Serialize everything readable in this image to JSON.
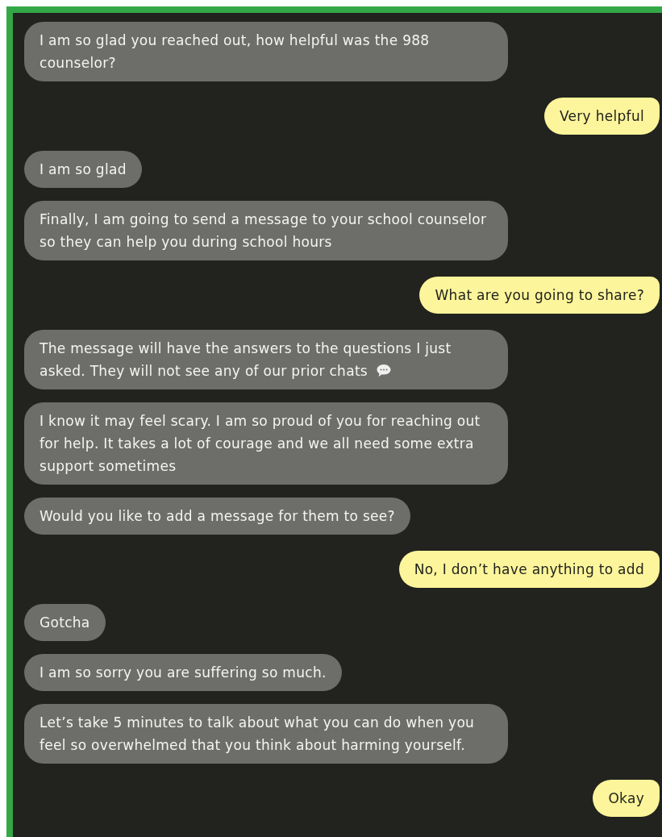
{
  "messages": [
    {
      "kind": "bot",
      "text": "I am so glad you reached out, how helpful was the 988 counselor?",
      "icon": false
    },
    {
      "kind": "user",
      "text": "Very helpful",
      "icon": false
    },
    {
      "kind": "bot",
      "text": "I am so glad",
      "icon": false
    },
    {
      "kind": "bot",
      "text": "Finally, I am going to send a message to your school counselor so they can help you during school hours",
      "icon": false
    },
    {
      "kind": "user",
      "text": "What are you going to share?",
      "icon": false
    },
    {
      "kind": "bot",
      "text": "The message will have the answers to the questions I just asked. They will not see any of our prior chats",
      "icon": true
    },
    {
      "kind": "bot",
      "text": "I know it may feel scary. I am so proud of you for reaching out for help. It takes a lot of courage and we all need some extra support sometimes",
      "icon": false
    },
    {
      "kind": "bot",
      "text": "Would you like to add a message for them to see?",
      "icon": false
    },
    {
      "kind": "user",
      "text": "No, I don’t have anything to add",
      "icon": false
    },
    {
      "kind": "bot",
      "text": "Gotcha",
      "icon": false
    },
    {
      "kind": "bot",
      "text": "I am so sorry you are suffering so much.",
      "icon": false
    },
    {
      "kind": "bot",
      "text": "Let’s take 5 minutes to talk about what you can do when you feel so overwhelmed that you think about harming yourself.",
      "icon": false
    },
    {
      "kind": "user",
      "text": "Okay",
      "icon": false
    }
  ]
}
